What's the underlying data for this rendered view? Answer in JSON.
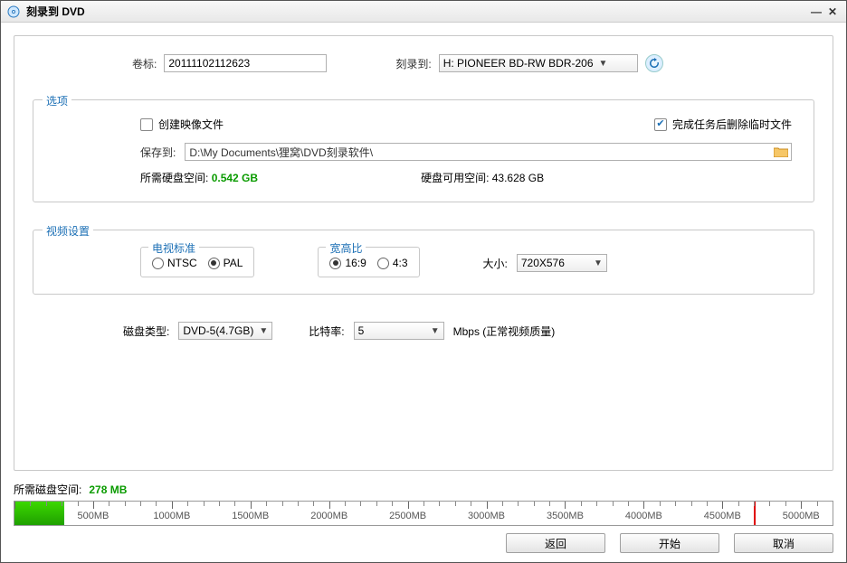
{
  "title": "刻录到 DVD",
  "top": {
    "volume_label": "卷标:",
    "volume_value": "20111102112623",
    "burnto_label": "刻录到:",
    "burnto_value": "H: PIONEER  BD-RW   BDR-206"
  },
  "options": {
    "legend": "选项",
    "create_image_label": "创建映像文件",
    "delete_temp_label": "完成任务后删除临时文件",
    "saveto_label": "保存到:",
    "saveto_path": "D:\\My Documents\\狸窝\\DVD刻录软件\\",
    "disk_needed_label": "所需硬盘空间:",
    "disk_needed_value": "0.542 GB",
    "disk_free_label": "硬盘可用空间:",
    "disk_free_value": "43.628 GB"
  },
  "video": {
    "legend": "视频设置",
    "tv_legend": "电视标准",
    "tv_ntsc": "NTSC",
    "tv_pal": "PAL",
    "aspect_legend": "宽高比",
    "aspect_169": "16:9",
    "aspect_43": "4:3",
    "size_label": "大小:",
    "size_value": "720X576"
  },
  "disk": {
    "type_label": "磁盘类型:",
    "type_value": "DVD-5(4.7GB)",
    "bitrate_label": "比特率:",
    "bitrate_value": "5",
    "bitrate_unit": "Mbps  (正常视频质量)"
  },
  "footer": {
    "req_label": "所需磁盘空间:",
    "req_value": "278 MB",
    "ticks": [
      "500MB",
      "1000MB",
      "1500MB",
      "2000MB",
      "2500MB",
      "3000MB",
      "3500MB",
      "4000MB",
      "4500MB",
      "5000MB"
    ]
  },
  "buttons": {
    "back": "返回",
    "start": "开始",
    "cancel": "取消"
  }
}
